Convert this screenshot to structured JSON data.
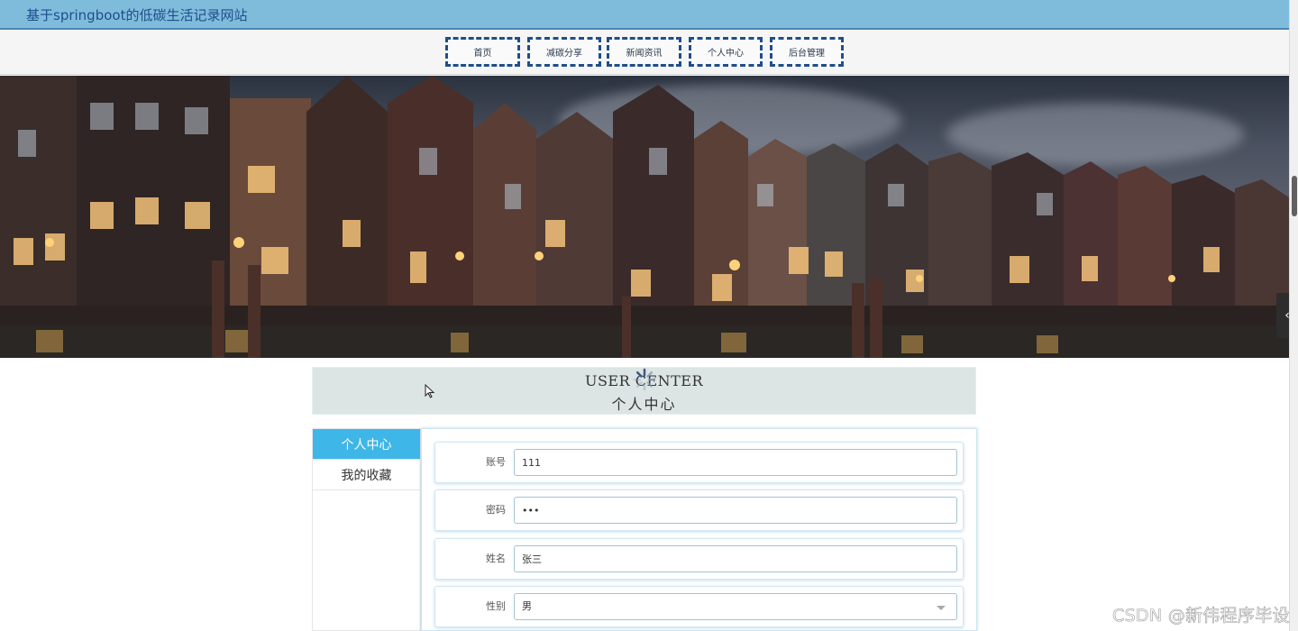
{
  "header": {
    "site_title": "基于springboot的低碳生活记录网站"
  },
  "nav": {
    "items": [
      {
        "label": "首页"
      },
      {
        "label": "减碳分享"
      },
      {
        "label": "新闻资讯"
      },
      {
        "label": "个人中心"
      },
      {
        "label": "后台管理"
      }
    ]
  },
  "banner": {
    "slide_count": 3,
    "active_slide": 1
  },
  "user_center": {
    "title_en": "USER CENTER",
    "title_cn": "个人中心"
  },
  "side_menu": {
    "items": [
      {
        "label": "个人中心",
        "active": true
      },
      {
        "label": "我的收藏",
        "active": false
      }
    ]
  },
  "form": {
    "fields": [
      {
        "label": "账号",
        "value": "111"
      },
      {
        "label": "密码",
        "value": "•••"
      },
      {
        "label": "姓名",
        "value": "张三"
      },
      {
        "label": "性别",
        "value": "男"
      }
    ]
  },
  "side_arrow": {
    "glyph": "‹"
  },
  "watermark": "CSDN @新伟程序毕设",
  "colors": {
    "topbar": "#7fbcdc",
    "accent": "#3fb6e8",
    "nav_border": "#1f4e8a",
    "active_dot": "#1e90e0"
  }
}
